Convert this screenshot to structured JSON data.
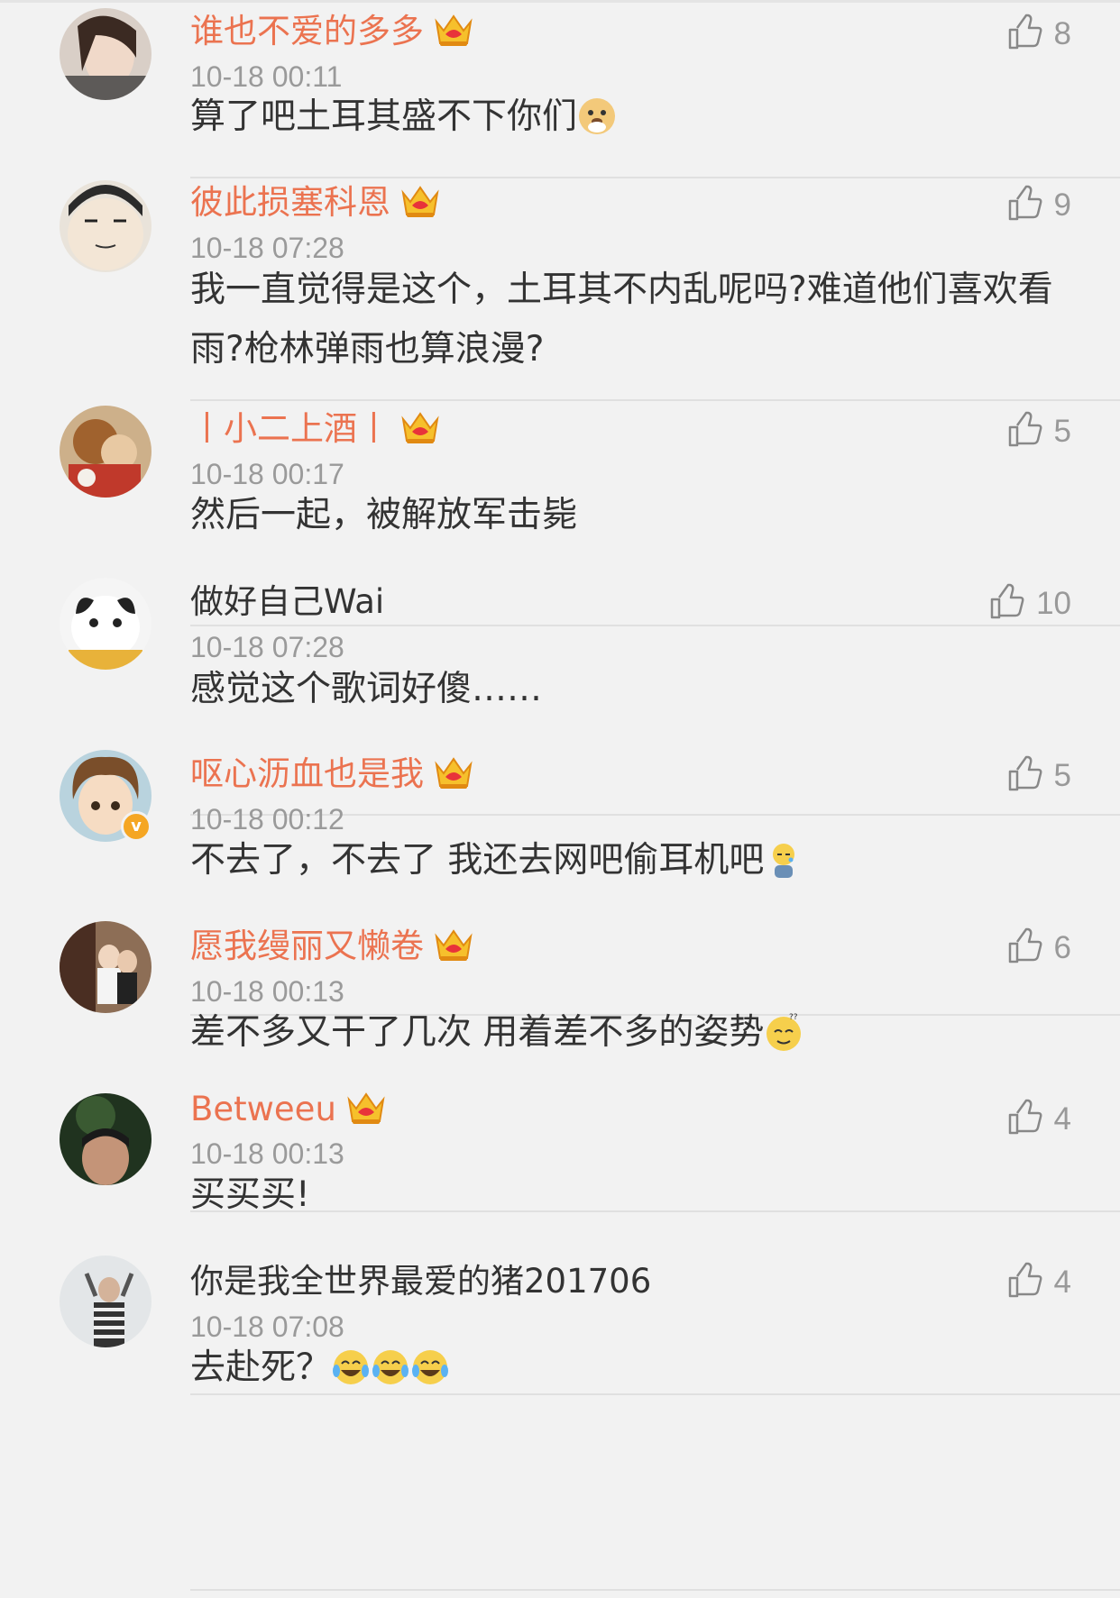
{
  "comments": [
    {
      "user": "谁也不爱的多多",
      "vip": true,
      "time": "10-18 00:11",
      "text": "算了吧土耳其盛不下你们",
      "emoji": [
        "doge-emoji"
      ],
      "likes": "8",
      "avatar": "avatar-woman"
    },
    {
      "user": "彼此损塞科恩",
      "vip": true,
      "time": "10-18 07:28",
      "text": "我一直觉得是这个，土耳其不内乱呢吗?难道他们喜欢看雨?枪林弹雨也算浪漫?",
      "emoji": [],
      "likes": "9",
      "avatar": "avatar-cartoon"
    },
    {
      "user": "丨小二上酒丨",
      "vip": true,
      "time": "10-18 00:17",
      "text": "然后一起，被解放军击毙",
      "emoji": [],
      "likes": "5",
      "avatar": "avatar-photo"
    },
    {
      "user": "做好自己Wai",
      "vip": false,
      "time": "10-18 07:28",
      "text": "感觉这个歌词好傻……",
      "emoji": [],
      "likes": "10",
      "avatar": "avatar-cat"
    },
    {
      "user": "呕心沥血也是我",
      "vip": true,
      "time": "10-18 00:12",
      "text": "不去了，不去了 我还去网吧偷耳机吧",
      "emoji": [
        "sad-emoji"
      ],
      "likes": "5",
      "avatar": "avatar-anime",
      "verified": true
    },
    {
      "user": "愿我缦丽又懒卷",
      "vip": true,
      "time": "10-18 00:13",
      "text": "差不多又干了几次 用着差不多的姿势",
      "emoji": [
        "dizzy-emoji"
      ],
      "likes": "6",
      "avatar": "avatar-couple"
    },
    {
      "user": "Betweeu",
      "vip": true,
      "time": "10-18 00:13",
      "text": "买买买!",
      "emoji": [],
      "likes": "4",
      "avatar": "avatar-man"
    },
    {
      "user": "你是我全世界最爱的猪201706",
      "vip": false,
      "time": "10-18 07:08",
      "text": "去赴死？",
      "emoji": [
        "laugh-cry-emoji",
        "laugh-cry-emoji",
        "laugh-cry-emoji"
      ],
      "likes": "4",
      "avatar": "avatar-person"
    }
  ],
  "colors": {
    "vip_name": "#eb7350",
    "normal_name": "#333333",
    "time": "#9a9a9a",
    "background": "#f2f2f2"
  }
}
